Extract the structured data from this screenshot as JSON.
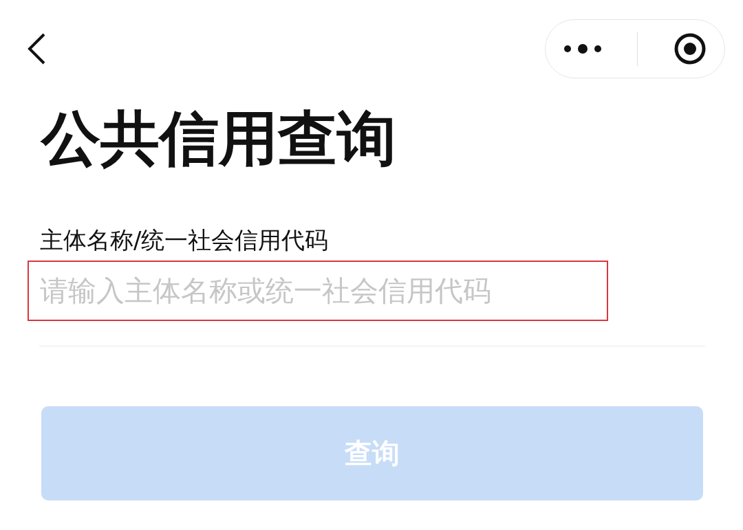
{
  "page": {
    "title": "公共信用查询"
  },
  "field": {
    "label": "主体名称/统一社会信用代码",
    "placeholder": "请输入主体名称或统一社会信用代码",
    "highlighted": true
  },
  "submit_button": {
    "label": "查询",
    "disabled": true
  }
}
